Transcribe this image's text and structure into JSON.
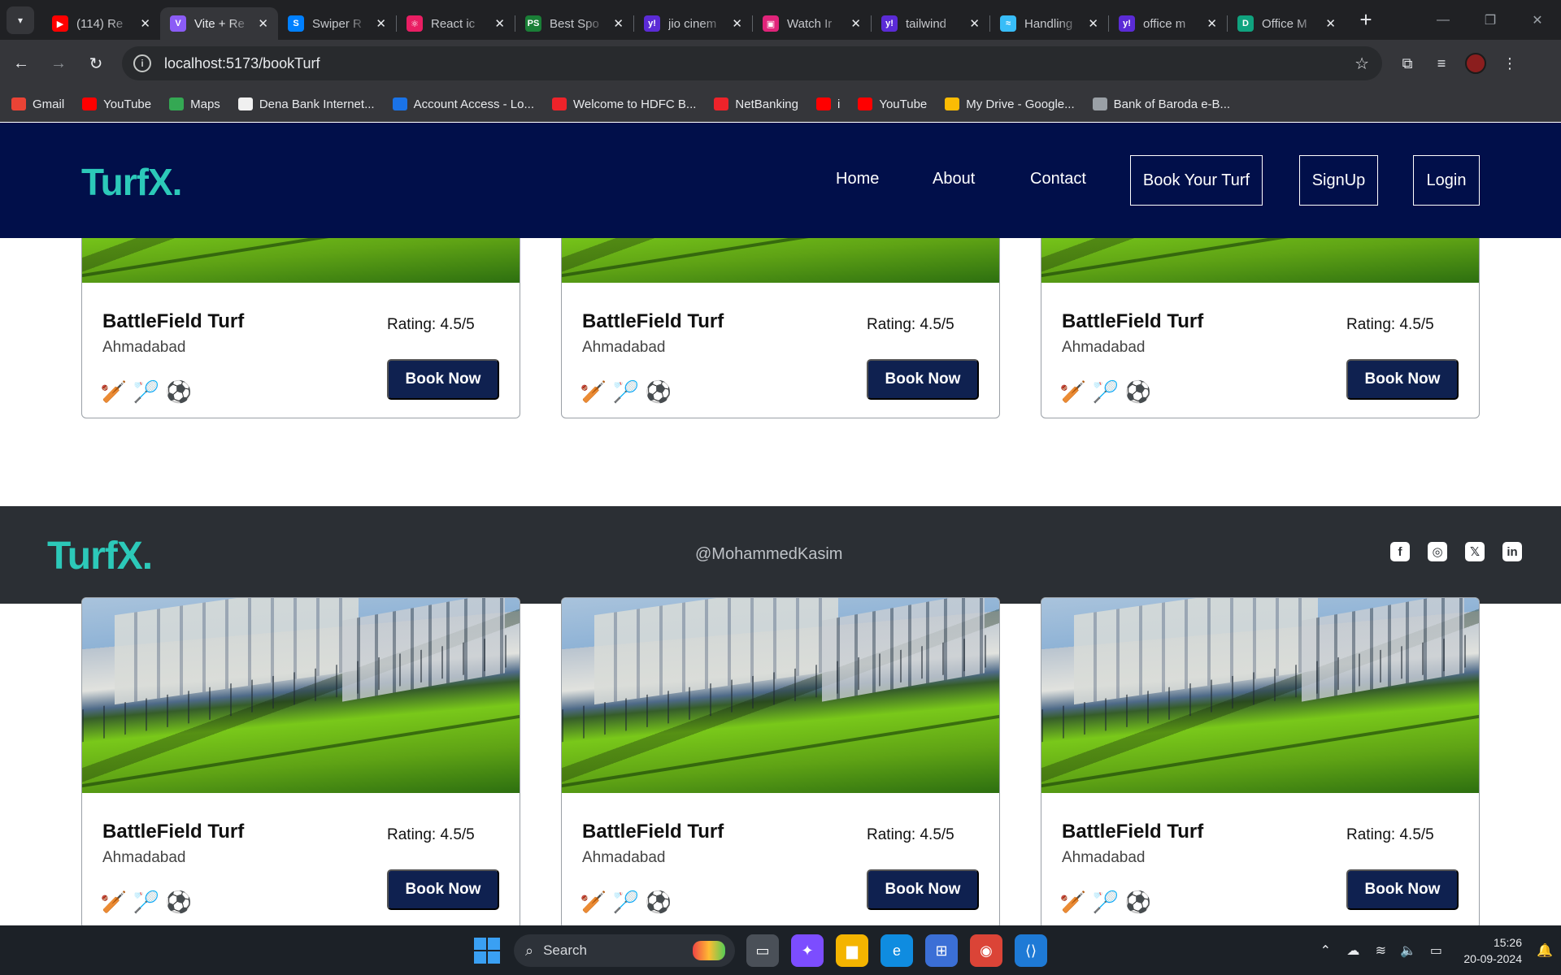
{
  "browser": {
    "tab_search_icon": "chevron-down",
    "tabs": [
      {
        "title": "(114) Re",
        "favicon_color": "#ff0000",
        "favicon_glyph": "▶",
        "active": false
      },
      {
        "title": "Vite + Re",
        "favicon_color": "#8b5cf6",
        "favicon_glyph": "V",
        "active": true
      },
      {
        "title": "Swiper R",
        "favicon_color": "#0080ff",
        "favicon_glyph": "S",
        "active": false
      },
      {
        "title": "React ic",
        "favicon_color": "#e91e63",
        "favicon_glyph": "⚛",
        "active": false
      },
      {
        "title": "Best Spo",
        "favicon_color": "#1a7f37",
        "favicon_glyph": "PS",
        "active": false
      },
      {
        "title": "jio cinem",
        "favicon_color": "#5b2bd6",
        "favicon_glyph": "y!",
        "active": false
      },
      {
        "title": "Watch Ir",
        "favicon_color": "#e0247a",
        "favicon_glyph": "▣",
        "active": false
      },
      {
        "title": "tailwind",
        "favicon_color": "#5b2bd6",
        "favicon_glyph": "y!",
        "active": false
      },
      {
        "title": "Handling",
        "favicon_color": "#38bdf8",
        "favicon_glyph": "≈",
        "active": false
      },
      {
        "title": "office m",
        "favicon_color": "#5b2bd6",
        "favicon_glyph": "y!",
        "active": false
      },
      {
        "title": "Office M",
        "favicon_color": "#10a37f",
        "favicon_glyph": "D",
        "active": false
      }
    ],
    "close_glyph": "✕",
    "new_tab_glyph": "+",
    "window_controls": {
      "minimize": "—",
      "restore": "❐",
      "close": "✕"
    },
    "address": "localhost:5173/bookTurf",
    "bookmarks": [
      {
        "label": "Gmail",
        "color": "#ea4335"
      },
      {
        "label": "YouTube",
        "color": "#ff0000"
      },
      {
        "label": "Maps",
        "color": "#34a853"
      },
      {
        "label": "Dena Bank Internet...",
        "color": "#f0f0f0"
      },
      {
        "label": "Account Access - Lo...",
        "color": "#1a73e8"
      },
      {
        "label": "Welcome to HDFC B...",
        "color": "#ed232a"
      },
      {
        "label": "NetBanking",
        "color": "#ed232a"
      },
      {
        "label": "i",
        "color": "#ff0000"
      },
      {
        "label": "YouTube",
        "color": "#ff0000"
      },
      {
        "label": "My Drive - Google...",
        "color": "#fbbc04"
      },
      {
        "label": "Bank of Baroda e-B...",
        "color": "#9aa0a6"
      }
    ]
  },
  "site": {
    "logo": "TurfX.",
    "nav_links": [
      "Home",
      "About",
      "Contact"
    ],
    "nav_buttons": [
      "Book Your Turf",
      "SignUp",
      "Login"
    ],
    "footer": {
      "logo": "TurfX.",
      "credit": "@MohammedKasim",
      "social_icons": [
        "facebook-icon",
        "instagram-icon",
        "x-icon",
        "linkedin-icon"
      ]
    },
    "cards": [
      {
        "name": "BattleField Turf",
        "location": "Ahmadabad",
        "rating": "Rating: 4.5/5",
        "cta": "Book Now"
      },
      {
        "name": "BattleField Turf",
        "location": "Ahmadabad",
        "rating": "Rating: 4.5/5",
        "cta": "Book Now"
      },
      {
        "name": "BattleField Turf",
        "location": "Ahmadabad",
        "rating": "Rating: 4.5/5",
        "cta": "Book Now"
      },
      {
        "name": "BattleField Turf",
        "location": "Ahmadabad",
        "rating": "Rating: 4.5/5",
        "cta": "Book Now"
      },
      {
        "name": "BattleField Turf",
        "location": "Ahmadabad",
        "rating": "Rating: 4.5/5",
        "cta": "Book Now"
      },
      {
        "name": "BattleField Turf",
        "location": "Ahmadabad",
        "rating": "Rating: 4.5/5",
        "cta": "Book Now"
      }
    ],
    "sport_icons": [
      "cricket-icon",
      "badminton-icon",
      "football-icon"
    ],
    "colors": {
      "navbar_bg": "#010f4a",
      "logo": "#2cc9b9",
      "button_bg": "#0f2150",
      "footer_bg": "#2b2f34"
    }
  },
  "taskbar": {
    "search_placeholder": "Search",
    "time": "15:26",
    "date": "20-09-2024"
  }
}
